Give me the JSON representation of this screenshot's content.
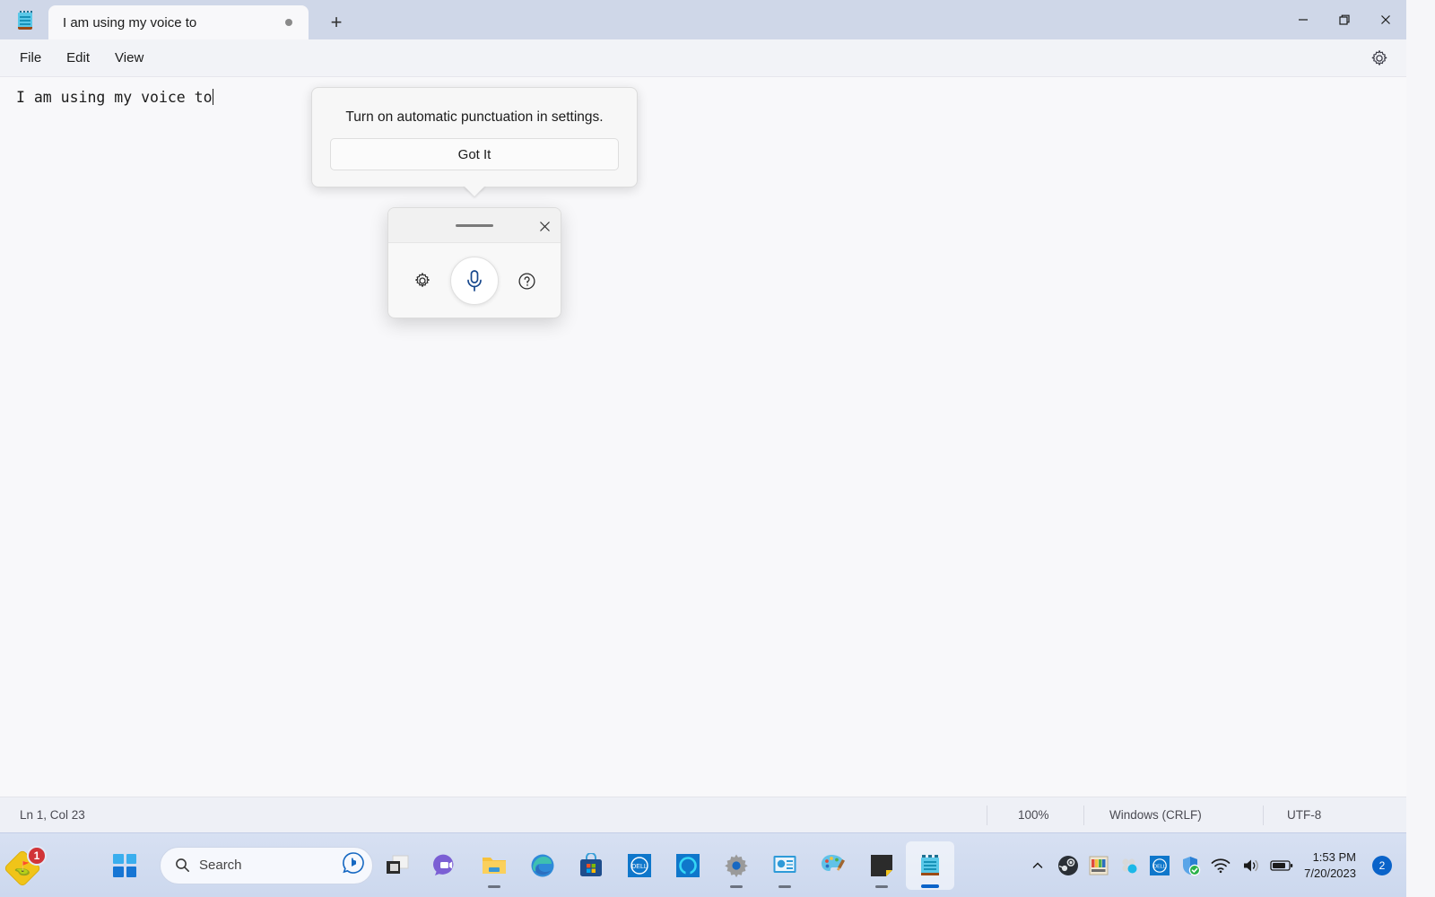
{
  "window": {
    "tab_title": "I am using my voice to",
    "tab_icon": "notepad-icon",
    "tab_modified_indicator": "●",
    "new_tab_label": "+",
    "controls": {
      "minimize": "minimize-icon",
      "restore": "restore-icon",
      "close": "close-icon"
    }
  },
  "menubar": {
    "items": [
      {
        "label": "File",
        "name": "menu-file"
      },
      {
        "label": "Edit",
        "name": "menu-edit"
      },
      {
        "label": "View",
        "name": "menu-view"
      }
    ],
    "settings_icon": "gear-icon"
  },
  "editor": {
    "text": "I am using my voice to"
  },
  "callout": {
    "message": "Turn on automatic punctuation in settings.",
    "button_label": "Got It"
  },
  "voice_panel": {
    "grip": "drag-handle",
    "close_icon": "close-icon",
    "settings_icon": "gear-icon",
    "mic_icon": "microphone-icon",
    "help_icon": "help-circle-icon",
    "mic_color": "#16478c"
  },
  "statusbar": {
    "position": "Ln 1, Col 23",
    "zoom": "100%",
    "line_ending": "Windows (CRLF)",
    "encoding": "UTF-8"
  },
  "taskbar": {
    "corner_badge_count": "1",
    "corner_icon": "construction-tag-icon",
    "start_label": "start-button",
    "search": {
      "placeholder": "Search",
      "icon": "search-icon",
      "assistant_icon": "bing-chat-icon"
    },
    "apps": [
      {
        "name": "task-view",
        "label": "T"
      },
      {
        "name": "chat-teams",
        "label": "▶"
      },
      {
        "name": "file-explorer",
        "label": "■",
        "running": true
      },
      {
        "name": "microsoft-edge",
        "label": "e"
      },
      {
        "name": "microsoft-store",
        "label": "⊞"
      },
      {
        "name": "dell-app",
        "label": "DELL"
      },
      {
        "name": "alexa-app",
        "label": "O"
      },
      {
        "name": "settings-app",
        "label": "⚙",
        "running": true
      },
      {
        "name": "display-manager-app",
        "label": "▤",
        "running": true
      },
      {
        "name": "paint-app",
        "label": "◑",
        "running": true
      },
      {
        "name": "sticky-notes-app",
        "label": "◢",
        "running": true
      },
      {
        "name": "notepad-app",
        "label": "≡",
        "running": true,
        "active": true
      }
    ],
    "tray": [
      {
        "name": "show-hidden-icons",
        "label": "⌃"
      },
      {
        "name": "steam-icon",
        "label": "S"
      },
      {
        "name": "color-profile-icon",
        "label": "▦"
      },
      {
        "name": "sync-app-icon",
        "label": "✿"
      },
      {
        "name": "dell-tray-icon",
        "label": "DELL"
      },
      {
        "name": "windows-security-icon",
        "label": "✓"
      },
      {
        "name": "wifi-icon",
        "label": "wifi"
      },
      {
        "name": "volume-icon",
        "label": "vol"
      },
      {
        "name": "battery-icon",
        "label": "batt"
      }
    ],
    "clock": {
      "time": "1:53 PM",
      "date": "7/20/2023"
    },
    "notification_count": "2"
  }
}
